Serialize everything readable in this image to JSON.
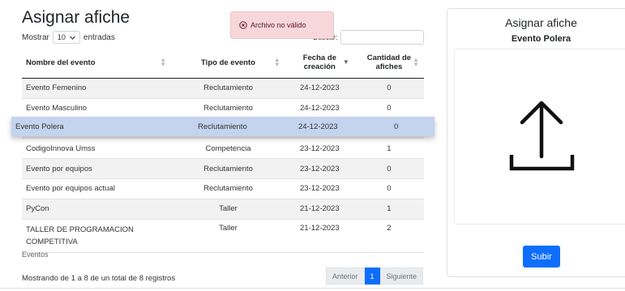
{
  "page": {
    "title": "Asignar afiche"
  },
  "length": {
    "prefix": "Mostrar",
    "value": "10",
    "suffix": "entradas"
  },
  "search": {
    "label": "Buscar:"
  },
  "toast": {
    "message": "Archivo no válido"
  },
  "table": {
    "headers": [
      "Nombre del evento",
      "Tipo de evento",
      "Fecha de creación",
      "Cantidad de afiches"
    ],
    "rows": [
      {
        "name": "Evento Femenino",
        "type": "Reclutamiento",
        "date": "24-12-2023",
        "count": "0"
      },
      {
        "name": "Evento Masculino",
        "type": "Reclutamiento",
        "date": "24-12-2023",
        "count": "0"
      },
      {
        "name": "CodigoInnova Umss",
        "type": "Competencia",
        "date": "23-12-2023",
        "count": "1"
      },
      {
        "name": "Evento por equipos",
        "type": "Reclutamiento",
        "date": "23-12-2023",
        "count": "0"
      },
      {
        "name": "Evento por equipos actual",
        "type": "Reclutamiento",
        "date": "23-12-2023",
        "count": "0"
      },
      {
        "name": "PyCon",
        "type": "Taller",
        "date": "21-12-2023",
        "count": "1"
      },
      {
        "name": "TALLER DE PROGRAMACION COMPETITIVA",
        "type": "Taller",
        "date": "21-12-2023",
        "count": "2"
      }
    ],
    "dragged_row": {
      "name": "Evento Polera",
      "type": "Reclutamiento",
      "date": "24-12-2023",
      "count": "0"
    },
    "caption": "Eventos"
  },
  "info": "Mostrando de 1 a 8 de un total de 8 registros",
  "pagination": {
    "prev": "Anterior",
    "current": "1",
    "next": "Siguiente"
  },
  "card": {
    "title": "Asignar afiche",
    "event_name": "Evento Polera",
    "upload_button": "Subir"
  },
  "colors": {
    "primary": "#0d6efd",
    "toast_bg": "#f8d7da",
    "drag_row": "#c4d4ef"
  }
}
